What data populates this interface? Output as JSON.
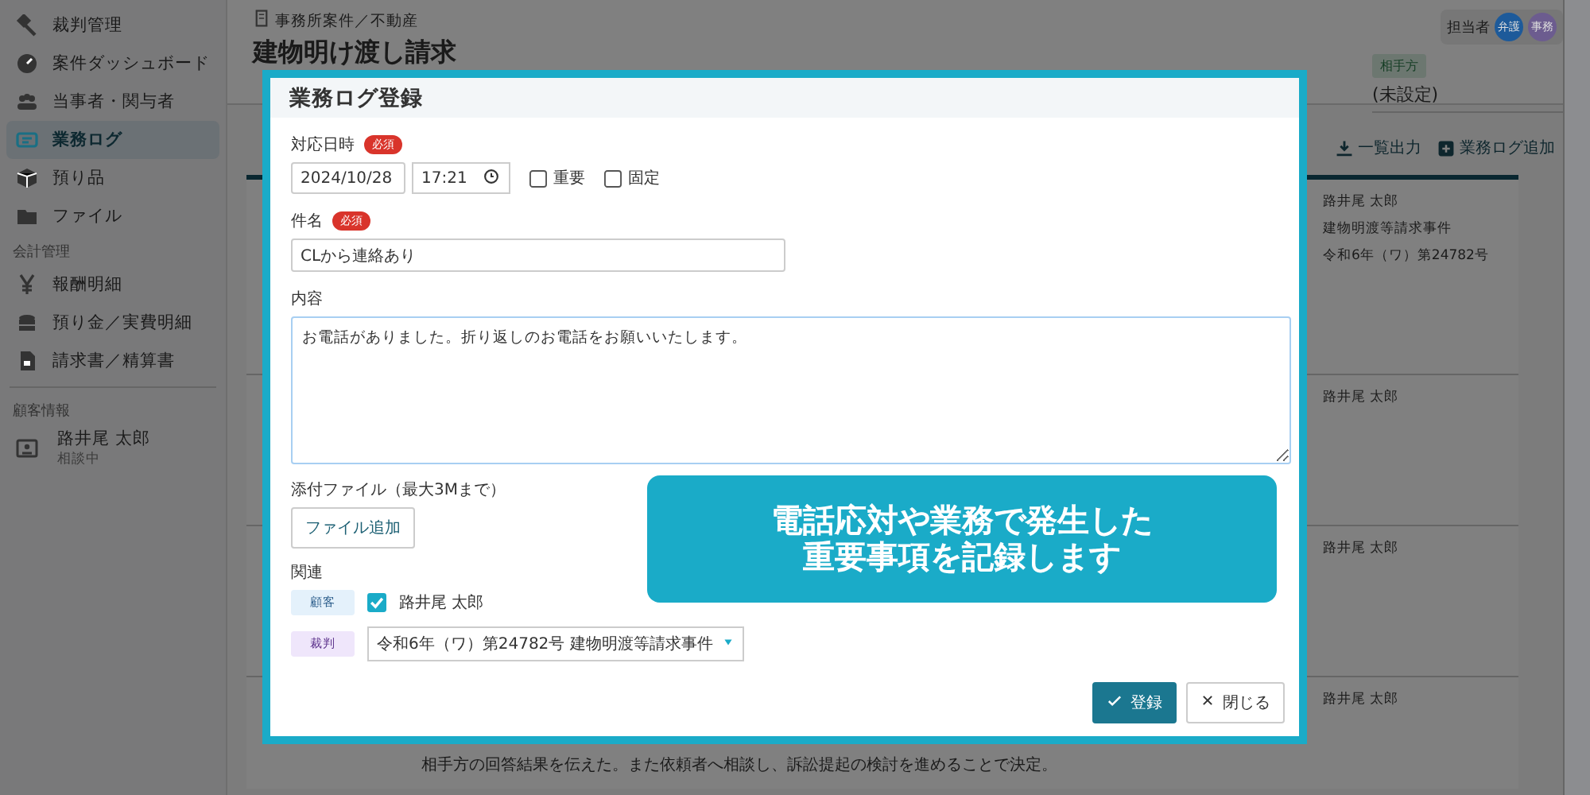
{
  "sidebar": {
    "items": [
      {
        "label": "裁判管理",
        "selected": false
      },
      {
        "label": "案件ダッシュボード",
        "selected": false
      },
      {
        "label": "当事者・関与者",
        "selected": false
      },
      {
        "label": "業務ログ",
        "selected": true
      },
      {
        "label": "預り品",
        "selected": false
      },
      {
        "label": "ファイル",
        "selected": false
      }
    ],
    "accounting": {
      "heading": "会計管理",
      "items": [
        {
          "label": "報酬明細",
          "selected": false
        },
        {
          "label": "預り金／実費明細",
          "selected": false
        },
        {
          "label": "請求書／精算書",
          "selected": false
        }
      ]
    },
    "client": {
      "heading": "顧客情報",
      "name": "路井尾 太郎",
      "status": "相談中"
    }
  },
  "header": {
    "breadcrumb": "事務所案件／不動産",
    "title": "建物明け渡し請求",
    "assignee_label": "担当者",
    "assignees": [
      {
        "label": "弁護",
        "color": "#1d5a9a"
      },
      {
        "label": "事務",
        "color": "#6c5c8f"
      }
    ],
    "opponent_tag": "相手方",
    "opponent": "(未設定)"
  },
  "toolbar": {
    "buttons": [
      "一覧出力",
      "業務ログ追加"
    ]
  },
  "log_list": {
    "rows": [
      {
        "lines": [
          "路井尾 太郎",
          "建物明渡等請求事件",
          "令和6年（ワ）第24782号"
        ]
      },
      {
        "lines": [
          "路井尾 太郎"
        ]
      },
      {
        "lines": [
          "路井尾 太郎"
        ]
      },
      {
        "lines": [
          "路井尾 太郎"
        ]
      }
    ],
    "footer_text": "相手方の回答結果を伝えた。また依頼者へ相談し、訴訟提起の検討を進めることで決定。"
  },
  "modal": {
    "title": "業務ログ登録",
    "date_label": "対応日時",
    "required": "必須",
    "date": "2024/10/28",
    "time": "17:21",
    "checkboxes": [
      {
        "label": "重要",
        "checked": false
      },
      {
        "label": "固定",
        "checked": false
      }
    ],
    "subject_label": "件名",
    "subject_required": "必須",
    "subject": "CLから連絡あり",
    "content_label": "内容",
    "content": "お電話がありました。折り返しのお電話をお願いいたします。",
    "attach_label": "添付ファイル（最大3Mまで）",
    "attach_button": "ファイル追加",
    "related_label": "関連",
    "client_tag": "顧客",
    "client_checked": true,
    "client_name": "路井尾 太郎",
    "case_tag": "裁判",
    "case_value": "令和6年（ワ）第24782号 建物明渡等請求事件",
    "submit": "登録",
    "close": "閉じる"
  },
  "callout": {
    "lines": [
      "電話応対や業務で発生した",
      "重要事項を記録します"
    ]
  }
}
